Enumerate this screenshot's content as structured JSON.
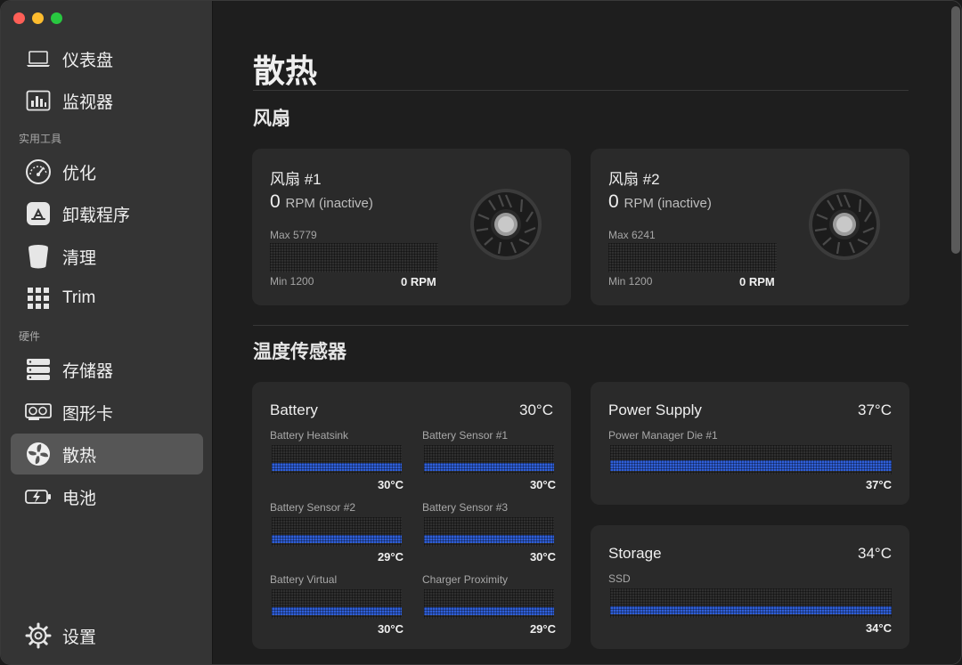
{
  "sidebar": {
    "items": [
      {
        "label": "仪表盘",
        "icon": "laptop-icon"
      },
      {
        "label": "监视器",
        "icon": "monitor-chart-icon"
      },
      {
        "label": "优化",
        "icon": "gauge-icon"
      },
      {
        "label": "卸载程序",
        "icon": "app-store-icon"
      },
      {
        "label": "清理",
        "icon": "trash-icon"
      },
      {
        "label": "Trim",
        "icon": "grid-icon"
      },
      {
        "label": "存储器",
        "icon": "storage-icon"
      },
      {
        "label": "图形卡",
        "icon": "gpu-icon"
      },
      {
        "label": "散热",
        "icon": "fan-icon"
      },
      {
        "label": "电池",
        "icon": "battery-icon"
      },
      {
        "label": "设置",
        "icon": "gear-icon"
      }
    ],
    "section_tools": "实用工具",
    "section_hardware": "硬件",
    "active": "散热"
  },
  "main": {
    "title": "散热",
    "fans_section": "风扇",
    "sensors_section": "温度传感器",
    "fans": [
      {
        "name": "风扇 #1",
        "rpm": "0",
        "rpm_unit": "RPM (inactive)",
        "max": "Max 5779",
        "min": "Min 1200",
        "current": "0 RPM"
      },
      {
        "name": "风扇 #2",
        "rpm": "0",
        "rpm_unit": "RPM (inactive)",
        "max": "Max 6241",
        "min": "Min 1200",
        "current": "0 RPM"
      }
    ],
    "sensor_groups": [
      {
        "name": "Battery",
        "temp": "30°C",
        "sensors": [
          {
            "label": "Battery Heatsink",
            "value": "30°C"
          },
          {
            "label": "Battery Sensor #1",
            "value": "30°C"
          },
          {
            "label": "Battery Sensor #2",
            "value": "29°C"
          },
          {
            "label": "Battery Sensor #3",
            "value": "30°C"
          },
          {
            "label": "Battery Virtual",
            "value": "30°C"
          },
          {
            "label": "Charger Proximity",
            "value": "29°C"
          }
        ]
      },
      {
        "name": "Power Supply",
        "temp": "37°C",
        "sensors": [
          {
            "label": "Power Manager Die #1",
            "value": "37°C"
          }
        ]
      },
      {
        "name": "Storage",
        "temp": "34°C",
        "sensors": [
          {
            "label": "SSD",
            "value": "34°C"
          }
        ]
      }
    ]
  },
  "colors": {
    "accent_bar": "#2f5fd8",
    "sidebar_bg": "#343434",
    "active_item_bg": "#565656",
    "card_bg": "#2a2a2a"
  }
}
